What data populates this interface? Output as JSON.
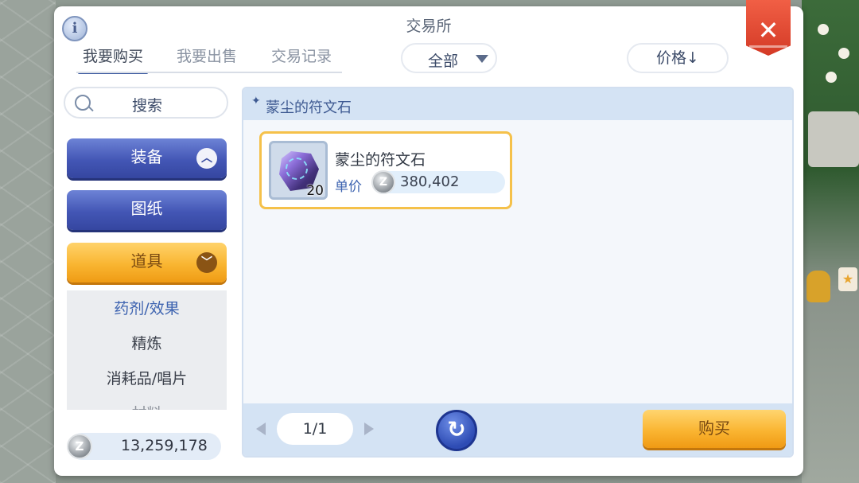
{
  "window": {
    "title": "交易所",
    "close_icon": "close-icon",
    "info_icon": "info-icon"
  },
  "tabs": [
    {
      "label": "我要购买",
      "active": true
    },
    {
      "label": "我要出售",
      "active": false
    },
    {
      "label": "交易记录",
      "active": false
    }
  ],
  "filter": {
    "selected": "全部"
  },
  "sort": {
    "label": "价格↓"
  },
  "search": {
    "label": "搜索"
  },
  "categories": [
    {
      "label": "装备",
      "state": "expanded-up",
      "color": "blue"
    },
    {
      "label": "图纸",
      "state": "none",
      "color": "blue"
    },
    {
      "label": "道具",
      "state": "expanded-down",
      "color": "orange"
    }
  ],
  "subcategories": [
    {
      "label": "药剂/效果",
      "active": true
    },
    {
      "label": "精炼",
      "active": false
    },
    {
      "label": "消耗品/唱片",
      "active": false
    },
    {
      "label": "材料",
      "active": false
    }
  ],
  "wallet": {
    "currency_icon": "zeny-coin-icon",
    "amount": "13,259,178"
  },
  "panel": {
    "header_label": "蒙尘的符文石"
  },
  "items": [
    {
      "name": "蒙尘的符文石",
      "quantity": "20",
      "unit_price_label": "单价",
      "unit_price": "380,402",
      "icon": "rune-stone-icon"
    }
  ],
  "pagination": {
    "page": "1/1"
  },
  "buttons": {
    "buy": "购买",
    "refresh_icon": "refresh-icon"
  },
  "colors": {
    "accent_blue": "#4356b5",
    "accent_orange": "#f9b531",
    "close_red": "#e04a32",
    "item_border": "#f5c14a"
  },
  "coin_glyph": "Z",
  "refresh_glyph": "↻",
  "info_glyph": "i",
  "close_glyph": "✕"
}
